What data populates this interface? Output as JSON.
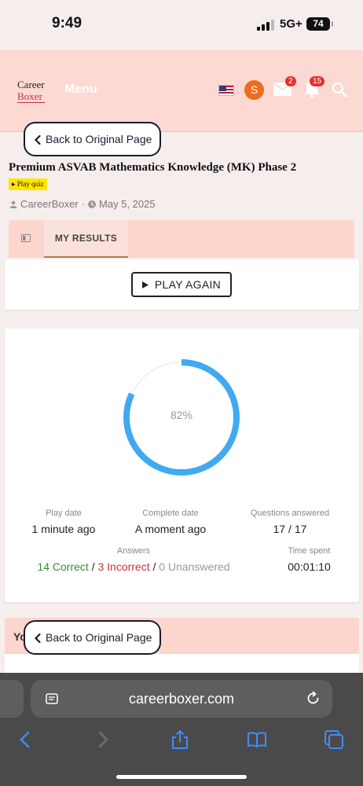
{
  "status_bar": {
    "time": "9:49",
    "network": "5G+",
    "battery": "74"
  },
  "header": {
    "logo_line1": "Career",
    "logo_line2": "Boxer",
    "menu_label": "Menu",
    "avatar_letter": "S",
    "mail_count": "2",
    "notification_count": "15",
    "flag_icon": "us-flag-icon"
  },
  "back_button": {
    "label": "Back to Original Page"
  },
  "quiz": {
    "title": "Premium ASVAB Mathematics Knowledge (MK) Phase 2",
    "tag": "Play quiz",
    "author": "CareerBoxer",
    "date": "May 5, 2025"
  },
  "tabs": {
    "active_label": "MY RESULTS"
  },
  "play_again": {
    "label": "PLAY AGAIN"
  },
  "results": {
    "percent_label": "82%",
    "percent_value": 0.82,
    "accent_color": "#40aaf0",
    "stats": {
      "play_date_label": "Play date",
      "play_date_value": "1 minute ago",
      "complete_date_label": "Complete date",
      "complete_date_value": "A moment ago",
      "questions_label": "Questions answered",
      "questions_value": "17 / 17",
      "answers_label": "Answers",
      "correct": "14 Correct",
      "incorrect": "3 Incorrect",
      "unanswered": "0 Unanswered",
      "separator": "/",
      "time_label": "Time spent",
      "time_value": "00:01:10"
    }
  },
  "partial_card": {
    "label": "Yo"
  },
  "browser": {
    "url": "careerboxer.com"
  }
}
